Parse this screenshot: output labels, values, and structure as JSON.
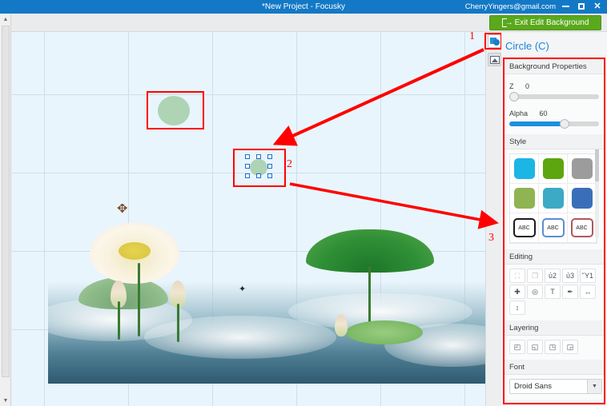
{
  "window": {
    "title": "*New Project - Focusky",
    "account": "CherryYingers@gmail.com",
    "minimize_label": "Minimize",
    "maximize_label": "Maximize",
    "close_label": "✕"
  },
  "toolbar": {
    "exit_edit_background_label": "Exit Edit Background",
    "exit_icon": "exit-door-icon"
  },
  "rail": {
    "shape_tool_label": "Shape Tool",
    "shape_icon": "shape-circle-square-icon",
    "image_tool_label": "Image Tool",
    "image_icon": "picture-icon"
  },
  "panel": {
    "title": "Circle (C)",
    "background_properties": {
      "heading": "Background Properties",
      "z": {
        "label": "Z",
        "value": "0",
        "percent": 0
      },
      "alpha": {
        "label": "Alpha",
        "value": "60",
        "percent": 60
      }
    },
    "style": {
      "heading": "Style",
      "swatches": [
        {
          "name": "style-cyan",
          "color": "#1cb6e4",
          "text": ""
        },
        {
          "name": "style-green",
          "color": "#5da60f",
          "text": ""
        },
        {
          "name": "style-gray",
          "color": "#9c9c9c",
          "text": ""
        },
        {
          "name": "style-olive",
          "color": "#90b452",
          "text": ""
        },
        {
          "name": "style-teal",
          "color": "#3ca9c5",
          "text": ""
        },
        {
          "name": "style-blue",
          "color": "#3a6fb8",
          "text": ""
        },
        {
          "name": "style-abc-black",
          "color": "#1b1b1b",
          "text": "ABC"
        },
        {
          "name": "style-abc-blue",
          "color": "#5a8fd0",
          "text": "ABC"
        },
        {
          "name": "style-abc-red",
          "color": "#b0575f",
          "text": "ABC"
        }
      ]
    },
    "editing": {
      "heading": "Editing",
      "buttons": [
        {
          "name": "group-icon",
          "glyph": "⛶",
          "enabled": false
        },
        {
          "name": "ungroup-icon",
          "glyph": "❐",
          "enabled": false
        },
        {
          "name": "lock-icon",
          "glyph": "ὑ2",
          "enabled": true
        },
        {
          "name": "unlock-icon",
          "glyph": "ὑ3",
          "enabled": true
        },
        {
          "name": "delete-trash-icon",
          "glyph": "Ὕ1",
          "enabled": true
        },
        {
          "name": "add-icon",
          "glyph": "✚",
          "enabled": true
        },
        {
          "name": "rotate-icon",
          "glyph": "◎",
          "enabled": true
        },
        {
          "name": "text-icon",
          "glyph": "T",
          "enabled": true
        },
        {
          "name": "brush-icon",
          "glyph": "✒",
          "enabled": true
        },
        {
          "name": "align-horizontal-icon",
          "glyph": "↔",
          "enabled": true
        },
        {
          "name": "align-vertical-icon",
          "glyph": "↕",
          "enabled": true
        }
      ]
    },
    "layering": {
      "heading": "Layering",
      "buttons": [
        {
          "name": "bring-to-front-icon",
          "glyph": "◰"
        },
        {
          "name": "send-to-back-icon",
          "glyph": "◱"
        },
        {
          "name": "bring-forward-icon",
          "glyph": "◳"
        },
        {
          "name": "send-backward-icon",
          "glyph": "◲"
        }
      ]
    },
    "font": {
      "heading": "Font",
      "selected": "Droid Sans",
      "caret": "▼"
    }
  },
  "canvas": {
    "shape_unselected_label": "green circle shape",
    "shape_selected_label": "selected circle shape",
    "artwork_label": "lotus pond watercolor background"
  },
  "annotations": [
    {
      "name": "annotation-1",
      "text": "1"
    },
    {
      "name": "annotation-2",
      "text": "2"
    },
    {
      "name": "annotation-3",
      "text": "3"
    }
  ],
  "colors": {
    "titlebar": "#1379c6",
    "accent_green": "#5aa81c",
    "panel_title_blue": "#1a85d6",
    "annotation_red": "#ff0000",
    "canvas_bg": "#e9f5fc"
  }
}
